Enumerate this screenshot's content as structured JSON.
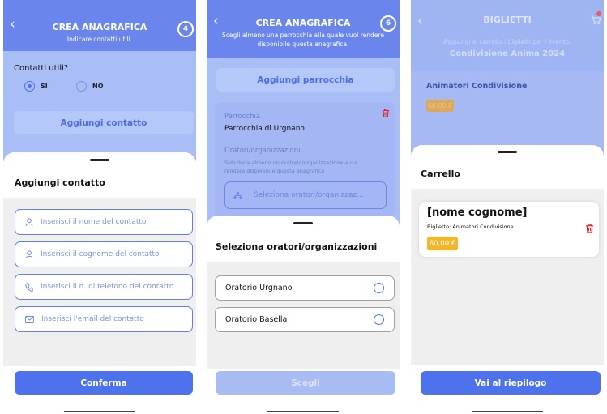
{
  "screen1": {
    "title": "CREA ANAGRAFICA",
    "subtitle": "Indicare contatti utili.",
    "step": "4",
    "question": "Contatti utili?",
    "radio_yes": "SI",
    "radio_no": "NO",
    "selected": "SI",
    "add_contact_button": "Aggiungi contatto",
    "sheet_title": "Aggiungi contatto",
    "fields": [
      {
        "placeholder": "Inserisci il nome del contatto",
        "icon": "user-icon"
      },
      {
        "placeholder": "Inserisci il cognome del contatto",
        "icon": "user-icon"
      },
      {
        "placeholder": "Inserisci il n. di telefono del contatto",
        "icon": "phone-icon"
      },
      {
        "placeholder": "Inserisci l'email del contatto",
        "icon": "mail-icon"
      }
    ],
    "confirm_button": "Conferma"
  },
  "screen2": {
    "title": "CREA ANAGRAFICA",
    "subtitle_line1": "Scegli almeno una parrocchia alla quale vuoi rendere",
    "subtitle_line2": "disponibile questa anagrafica.",
    "step": "6",
    "add_parish_button": "Aggiungi parrocchia",
    "parish_label": "Parrocchia",
    "parish_value": "Parrocchia di Urgnano",
    "oratori_label": "Oratori/organizzazioni",
    "oratori_help_line1": "Seleziona almeno un oratorio/organizzazione a cui",
    "oratori_help_line2": "rendere disponibile questa anagrafica",
    "oratori_select_placeholder": "Seleziona oratori/organizzaz...",
    "sheet_title": "Seleziona oratori/organizzazioni",
    "options": [
      "Oratorio Urgnano",
      "Oratorio Basella"
    ],
    "choose_button": "Scegli"
  },
  "screen3": {
    "title": "BIGLIETTI",
    "subtitle_line1": "Aggiungi al carrello i biglietti per l'evento:",
    "event_name": "Condivisione Anima 2024",
    "ticket_name": "Animatori Condivisione",
    "ticket_price": "60,00 €",
    "sheet_title": "Carrello",
    "cart_item_name": "[nome cognome]",
    "cart_item_ticket": "Biglietto: Animatori Condivisione",
    "cart_item_price": "60,00 €",
    "summary_button": "Vai al riepilogo"
  },
  "colors": {
    "primary": "#4d72ec",
    "header_blue": "#5678ec",
    "light_blue": "#a9bdf7",
    "price_yellow": "#f3b628",
    "delete_red": "#e01b24"
  }
}
